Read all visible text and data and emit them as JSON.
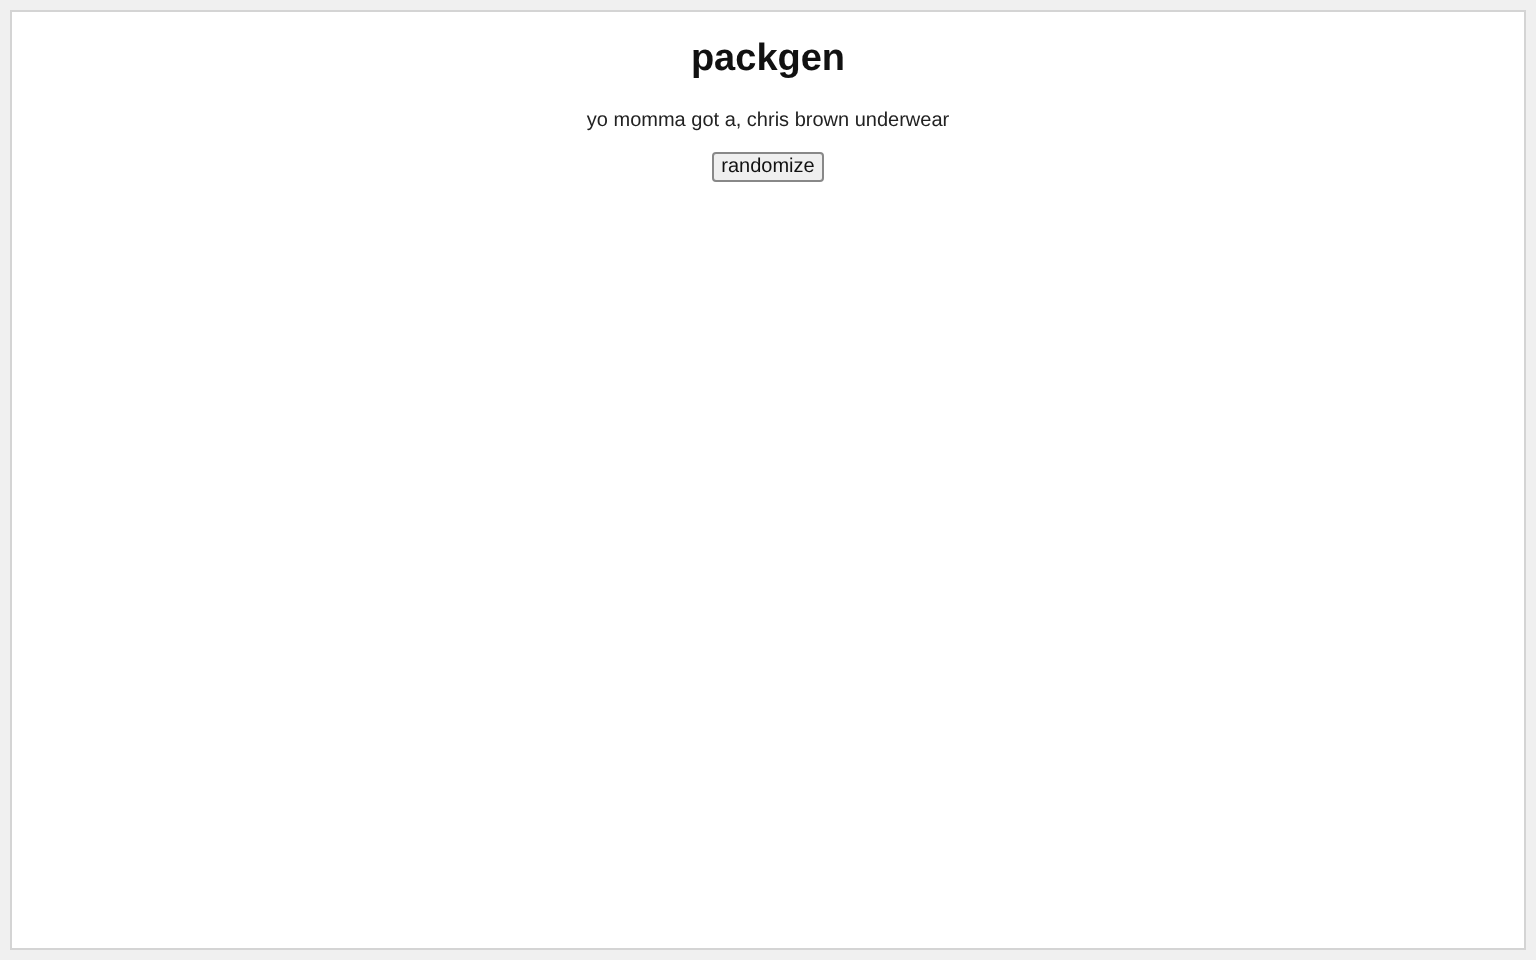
{
  "title": "packgen",
  "sentence": "yo momma got a, chris brown underwear",
  "button": "randomize"
}
